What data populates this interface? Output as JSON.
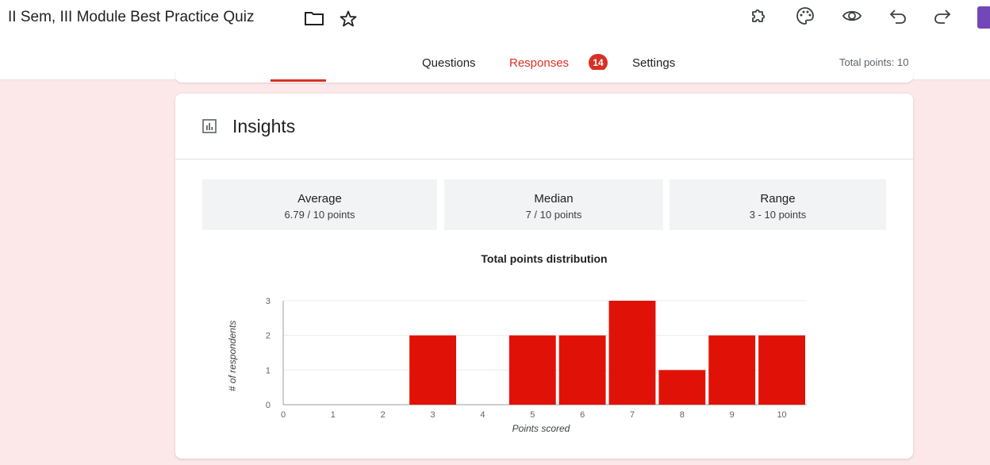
{
  "header": {
    "doc_title": "II Sem, III Module Best Practice Quiz",
    "icons": [
      "folder-icon",
      "star-icon",
      "addon-puzzle-icon",
      "palette-icon",
      "preview-eye-icon",
      "undo-icon",
      "redo-icon"
    ]
  },
  "tabs": [
    {
      "label": "Questions"
    },
    {
      "label": "Responses",
      "badge": "14",
      "active": true
    },
    {
      "label": "Settings"
    }
  ],
  "total_points": "Total points: 10",
  "insights": {
    "title": "Insights",
    "stats": [
      {
        "label": "Average",
        "value": "6.79 / 10 points"
      },
      {
        "label": "Median",
        "value": "7 / 10 points"
      },
      {
        "label": "Range",
        "value": "3 - 10 points"
      }
    ]
  },
  "colors": {
    "accent": "#d93025",
    "bar": "#e01208",
    "stat_bg": "#f1f3f4",
    "page_bg": "#fce8e8"
  },
  "chart_data": {
    "type": "bar",
    "title": "Total points distribution",
    "xlabel": "Points scored",
    "ylabel": "# of respondents",
    "categories": [
      "0",
      "1",
      "2",
      "3",
      "4",
      "5",
      "6",
      "7",
      "8",
      "9",
      "10"
    ],
    "values": [
      0,
      0,
      0,
      2,
      0,
      2,
      2,
      3,
      1,
      2,
      2
    ],
    "ylim": [
      0,
      3
    ],
    "yticks": [
      "0",
      "1",
      "2",
      "3"
    ],
    "grid": true,
    "legend": "none"
  }
}
